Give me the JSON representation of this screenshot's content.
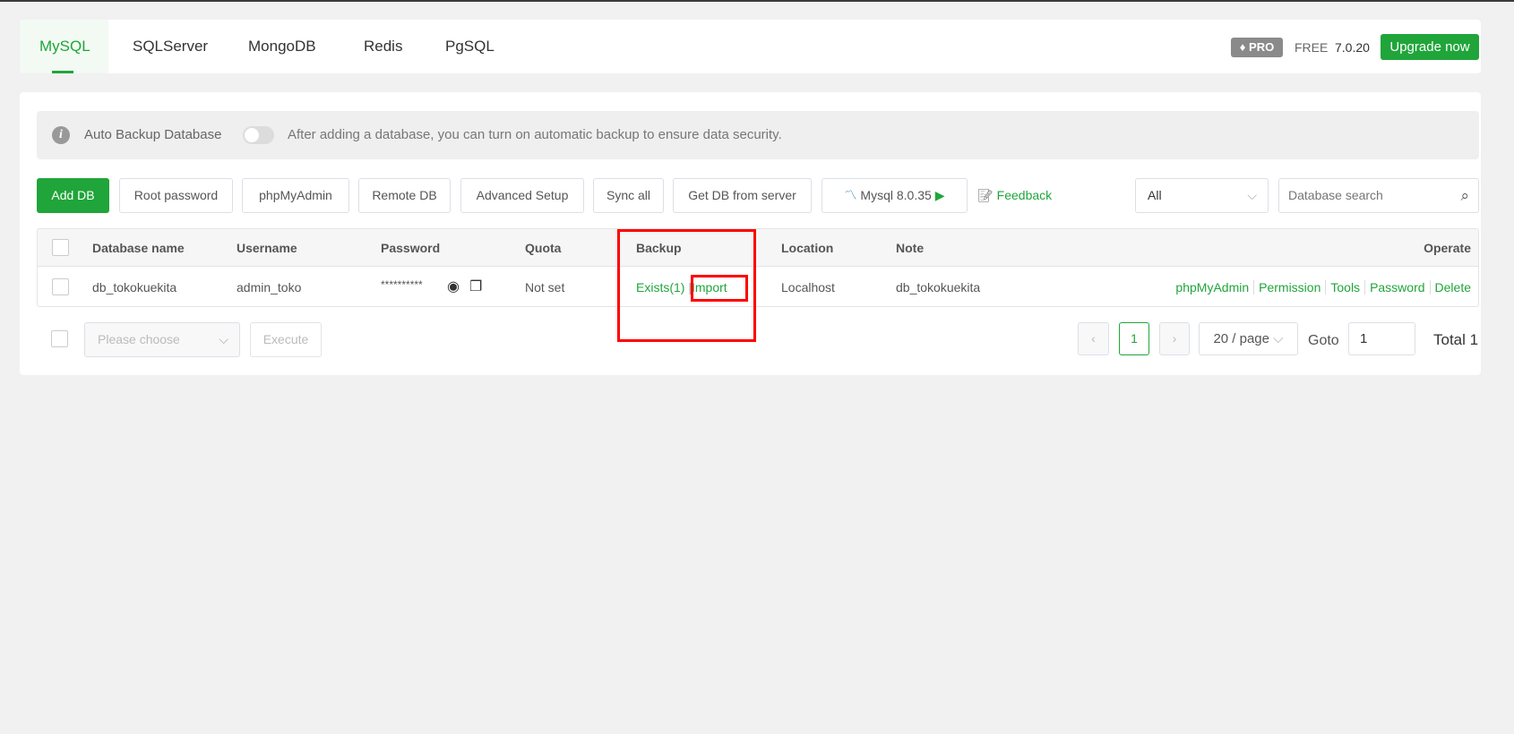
{
  "tabs": [
    {
      "label": "MySQL",
      "active": true
    },
    {
      "label": "SQLServer"
    },
    {
      "label": "MongoDB"
    },
    {
      "label": "Redis"
    },
    {
      "label": "PgSQL"
    }
  ],
  "header": {
    "pro_badge": "PRO",
    "edition": "FREE",
    "version": "7.0.20",
    "upgrade_label": "Upgrade now"
  },
  "alert": {
    "title": "Auto Backup Database",
    "toggle_on": false,
    "message": "After adding a database, you can turn on automatic backup to ensure data security."
  },
  "toolbar": {
    "add_db": "Add DB",
    "root_password": "Root password",
    "phpmyadmin": "phpMyAdmin",
    "remote_db": "Remote DB",
    "advanced_setup": "Advanced Setup",
    "sync_all": "Sync all",
    "get_db": "Get DB from server",
    "mysql_version": "Mysql 8.0.35",
    "feedback": "Feedback",
    "filter_value": "All",
    "search_placeholder": "Database search"
  },
  "table": {
    "headers": [
      "Database name",
      "Username",
      "Password",
      "Quota",
      "Backup",
      "Location",
      "Note",
      "Operate"
    ],
    "rows": [
      {
        "name": "db_tokokuekita",
        "username": "admin_toko",
        "password": "**********",
        "quota": "Not set",
        "backup_exists": "Exists(1)",
        "backup_import": "Import",
        "location": "Localhost",
        "note": "db_tokokuekita",
        "ops": [
          "phpMyAdmin",
          "Permission",
          "Tools",
          "Password",
          "Delete"
        ]
      }
    ]
  },
  "footer": {
    "batch_placeholder": "Please choose",
    "execute": "Execute",
    "page": "1",
    "per_page": "20 / page",
    "goto_label": "Goto",
    "goto_value": "1",
    "total": "Total 1"
  },
  "colors": {
    "accent": "#20a53a",
    "highlight": "#ff0000"
  }
}
